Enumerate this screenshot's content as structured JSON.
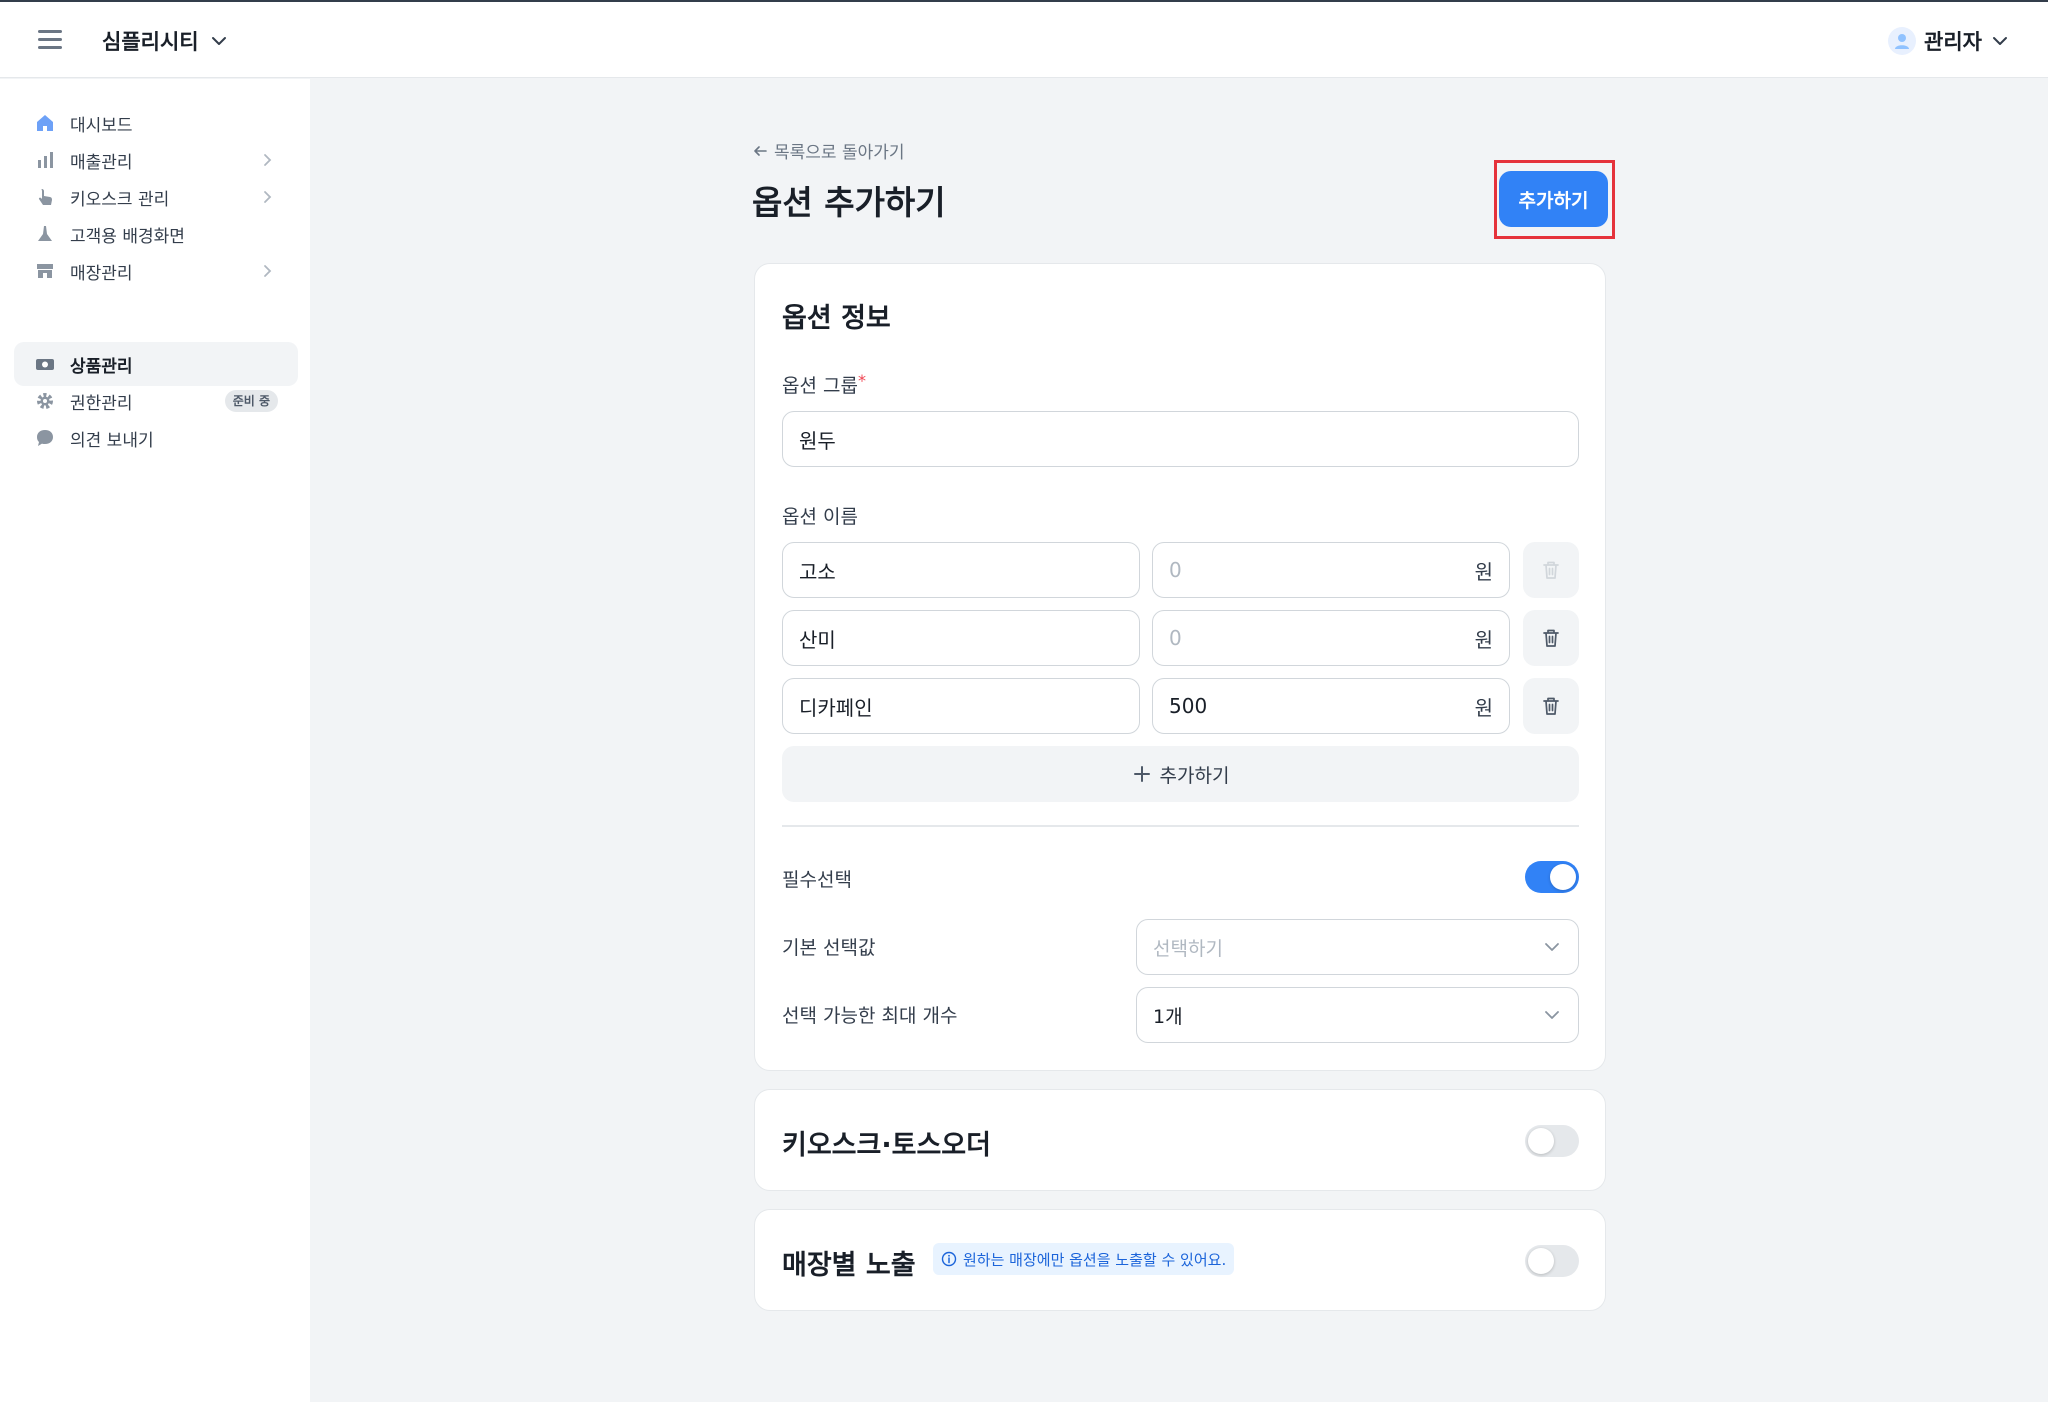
{
  "header": {
    "brand": "심플리시티",
    "user": "관리자"
  },
  "sidebar": {
    "items": [
      {
        "label": "대시보드",
        "icon": "home-icon"
      },
      {
        "label": "매출관리",
        "icon": "bar-chart-icon"
      },
      {
        "label": "키오스크 관리",
        "icon": "hand-pointer-icon"
      },
      {
        "label": "고객용 배경화면",
        "icon": "brush-icon"
      },
      {
        "label": "매장관리",
        "icon": "store-icon"
      },
      {
        "label": "상품관리",
        "icon": "product-icon",
        "active": true
      },
      {
        "label": "권한관리",
        "icon": "gear-icon",
        "badge": "준비 중"
      },
      {
        "label": "의견 보내기",
        "icon": "chat-bubble-icon"
      }
    ]
  },
  "main": {
    "back_link": "목록으로 돌아가기",
    "title": "옵션 추가하기",
    "submit_label": "추가하기"
  },
  "option_info": {
    "title": "옵션 정보",
    "group_label": "옵션 그룹",
    "required_mark": "*",
    "group_value": "원두",
    "name_label": "옵션 이름",
    "currency_unit": "원",
    "rows": [
      {
        "name": "고소",
        "price": "0",
        "price_is_placeholder": true
      },
      {
        "name": "산미",
        "price": "0",
        "price_is_placeholder": true
      },
      {
        "name": "디카페인",
        "price": "500",
        "price_is_placeholder": false
      }
    ],
    "add_row_label": "추가하기",
    "required_select_label": "필수선택",
    "required_select_on": true,
    "default_select_label": "기본 선택값",
    "default_select_placeholder": "선택하기",
    "max_count_label": "선택 가능한 최대 개수",
    "max_count_value": "1개"
  },
  "kiosk_card": {
    "title": "키오스크·토스오더",
    "enabled": false
  },
  "store_card": {
    "title": "매장별 노출",
    "info": "원하는 매장에만 옵션을 노출할 수 있어요.",
    "enabled": false
  },
  "colors": {
    "accent": "#3182f6",
    "highlight": "#e5323b"
  }
}
